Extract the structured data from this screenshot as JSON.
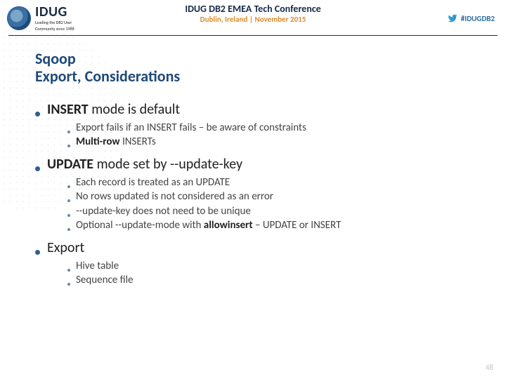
{
  "header": {
    "brand": "IDUG",
    "tagline1": "Leading the DB2 User",
    "tagline2": "Community since 1988",
    "conference_title": "IDUG DB2 EMEA Tech Conference",
    "conference_subtitle": "Dublin, Ireland | November 2015",
    "hashtag": "#IDUGDB2"
  },
  "title": {
    "line1": "Sqoop",
    "line2": "Export, Considerations"
  },
  "bullets": {
    "b1": {
      "text": "INSERT mode is default",
      "sub": [
        "Export fails if an INSERT fails – be aware of constraints",
        "Multi-row INSERTs"
      ]
    },
    "b2": {
      "text": "UPDATE mode set by --update-key",
      "sub": [
        "Each record is treated as an UPDATE",
        "No rows updated is not considered as an error",
        "--update-key does not need to be unique",
        "Optional --update-mode with allowinsert – UPDATE or INSERT"
      ]
    },
    "b3": {
      "text": "Export",
      "sub": [
        "Hive table",
        "Sequence file"
      ]
    }
  },
  "page_number": "48"
}
